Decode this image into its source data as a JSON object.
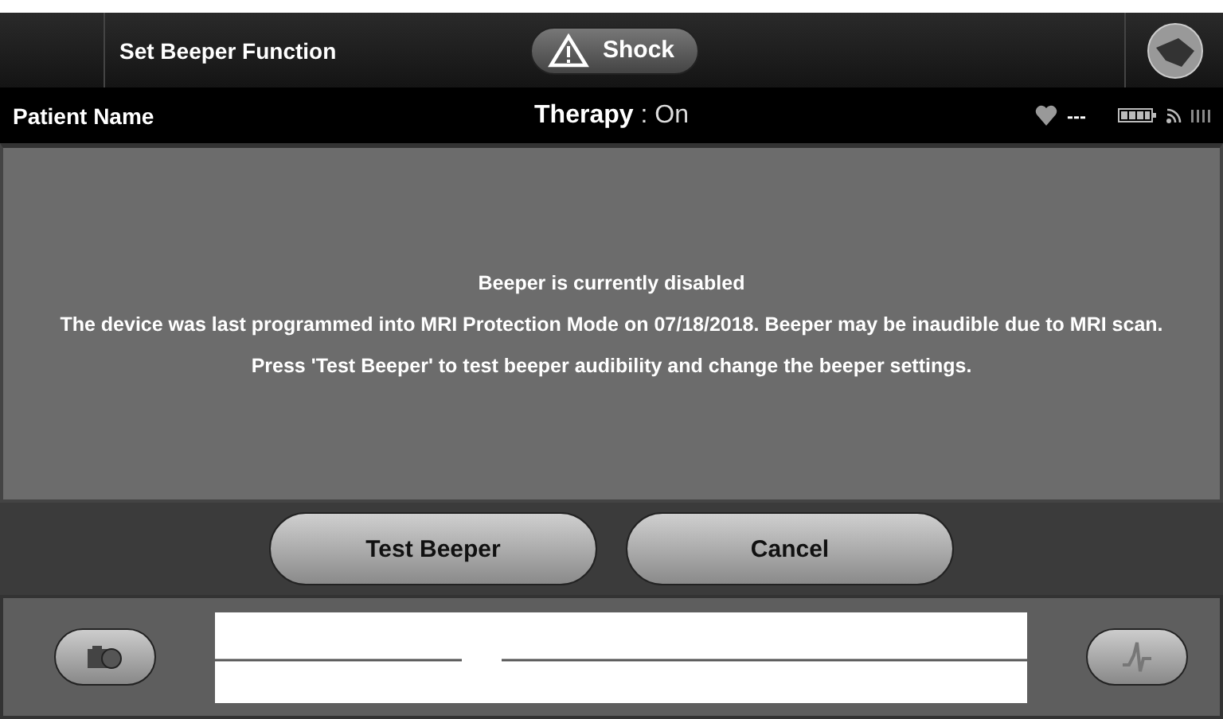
{
  "header": {
    "title": "Set Beeper Function",
    "shock_button": "Shock"
  },
  "status_bar": {
    "patient": "Patient Name",
    "therapy": "**Therapy** : On",
    "heart_rate": "---"
  },
  "message": {
    "lines": [
      "Beeper is currently disabled",
      "The device was last programmed into MRI Protection Mode on 07/18/2018. Beeper may be inaudible due to MRI scan.",
      "Press 'Test Beeper' to test beeper audibility and change the beeper settings."
    ]
  },
  "buttons": [
    "Test Beeper",
    "Cancel"
  ]
}
